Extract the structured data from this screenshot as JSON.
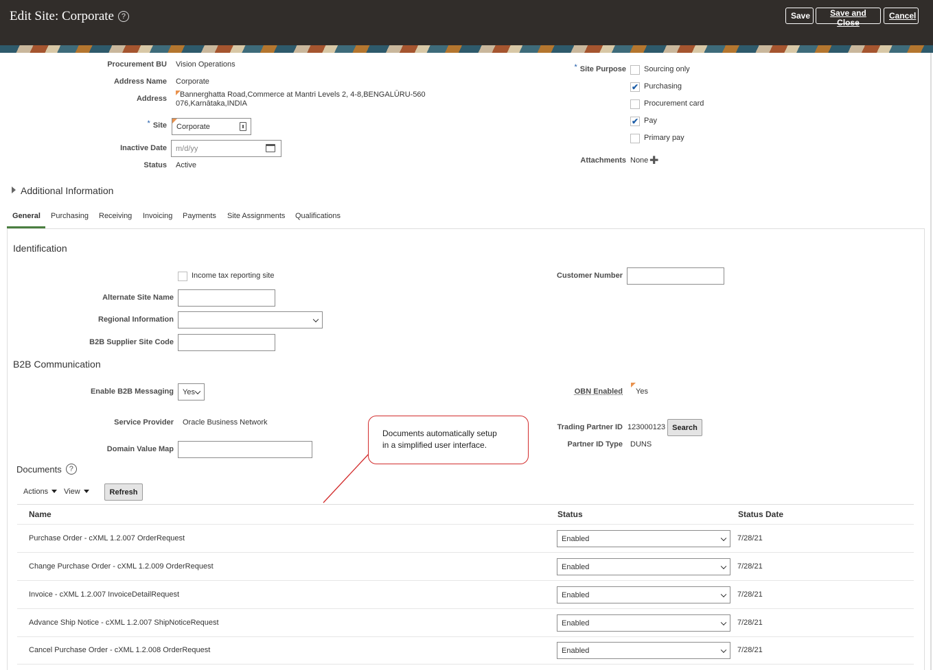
{
  "header": {
    "title": "Edit Site: Corporate",
    "help_icon": "?",
    "save": "Save",
    "save_and_close": "Save and Close",
    "cancel": "Cancel"
  },
  "site": {
    "procurement_bu_label": "Procurement BU",
    "procurement_bu": "Vision Operations",
    "address_name_label": "Address Name",
    "address_name": "Corporate",
    "address_label": "Address",
    "address_line1": "Bannerghatta Road,Commerce at Mantri Levels 2, 4-8,BENGALŪRU-560",
    "address_line2": "076,Karnātaka,INDIA",
    "site_label": "Site",
    "site_value": "Corporate",
    "inactive_date_label": "Inactive Date",
    "inactive_date_placeholder": "m/d/yy",
    "status_label": "Status",
    "status": "Active",
    "required_marker": "*"
  },
  "site_purpose": {
    "label": "Site Purpose",
    "options": [
      {
        "label": "Sourcing only",
        "checked": false
      },
      {
        "label": "Purchasing",
        "checked": true
      },
      {
        "label": "Procurement card",
        "checked": false
      },
      {
        "label": "Pay",
        "checked": true
      },
      {
        "label": "Primary pay",
        "checked": false
      }
    ],
    "check_glyph": "✔",
    "attachments_label": "Attachments",
    "attachments_value": "None",
    "add_glyph": "✚"
  },
  "additional_information": "Additional Information",
  "tabs": [
    "General",
    "Purchasing",
    "Receiving",
    "Invoicing",
    "Payments",
    "Site Assignments",
    "Qualifications"
  ],
  "identification": {
    "title": "Identification",
    "income_tax_label": "Income tax reporting site",
    "alternate_site_name_label": "Alternate Site Name",
    "regional_information_label": "Regional Information",
    "b2b_supplier_site_code_label": "B2B Supplier Site Code",
    "customer_number_label": "Customer Number"
  },
  "b2b": {
    "title": "B2B Communication",
    "enable_messaging_label": "Enable B2B Messaging",
    "enable_messaging_value": "Yes",
    "service_provider_label": "Service Provider",
    "service_provider": "Oracle Business Network",
    "domain_value_map_label": "Domain Value Map",
    "obn_enabled_label": "OBN Enabled",
    "obn_enabled_value": "Yes",
    "trading_partner_id_label": "Trading Partner ID",
    "trading_partner_id": "123000123",
    "search_button": "Search",
    "partner_id_type_label": "Partner ID Type",
    "partner_id_type": "DUNS"
  },
  "callout": {
    "line1": "Documents automatically setup",
    "line2": "in a simplified user interface."
  },
  "documents": {
    "title": "Documents",
    "actions": "Actions",
    "view": "View",
    "refresh": "Refresh",
    "columns": {
      "name": "Name",
      "status": "Status",
      "status_date": "Status Date"
    },
    "rows": [
      {
        "name": "Purchase Order - cXML 1.2.007 OrderRequest",
        "status": "Enabled",
        "date": "7/28/21"
      },
      {
        "name": "Change Purchase Order - cXML 1.2.009 OrderRequest",
        "status": "Enabled",
        "date": "7/28/21"
      },
      {
        "name": "Invoice - cXML 1.2.007 InvoiceDetailRequest",
        "status": "Enabled",
        "date": "7/28/21"
      },
      {
        "name": "Advance Ship Notice - cXML 1.2.007 ShipNoticeRequest",
        "status": "Enabled",
        "date": "7/28/21"
      },
      {
        "name": "Cancel Purchase Order - cXML 1.2.008 OrderRequest",
        "status": "Enabled",
        "date": "7/28/21"
      }
    ]
  },
  "colors": {
    "header_bg": "#312d2a",
    "accent_blue": "#1d5ea8",
    "tab_underline": "#4a7f3f",
    "callout_border": "#d22b2b"
  }
}
